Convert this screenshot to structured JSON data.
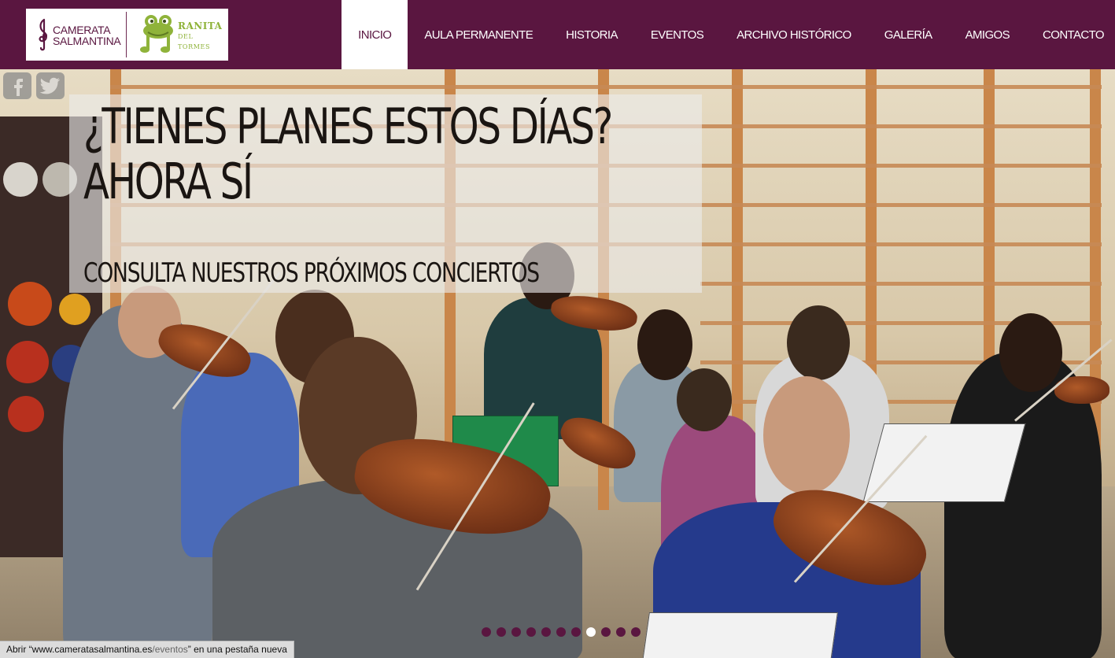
{
  "header": {
    "logo_primary": [
      "CAMERATA",
      "SALMANTINA"
    ],
    "logo_secondary": [
      "RANITA",
      "DEL TORMES"
    ],
    "brand_color": "#5a1640",
    "accent_green": "#8fb33a"
  },
  "nav": {
    "items": [
      {
        "label": "INICIO",
        "active": true
      },
      {
        "label": "AULA PERMANENTE",
        "active": false
      },
      {
        "label": "HISTORIA",
        "active": false
      },
      {
        "label": "EVENTOS",
        "active": false
      },
      {
        "label": "ARCHIVO HISTÓRICO",
        "active": false
      },
      {
        "label": "GALERÍA",
        "active": false
      },
      {
        "label": "AMIGOS",
        "active": false
      },
      {
        "label": "CONTACTO",
        "active": false
      }
    ]
  },
  "social": {
    "icons": [
      "facebook-icon",
      "twitter-icon"
    ]
  },
  "hero": {
    "title_line1": "¿TIENES PLANES ESTOS DÍAS?",
    "title_line2": "AHORA SÍ",
    "subtitle": "CONSULTA NUESTROS PRÓXIMOS CONCIERTOS"
  },
  "slider": {
    "dot_count": 11,
    "active_index": 7
  },
  "status": {
    "prefix": "Abrir “www.camerata salmantina.es",
    "domain": "www.cameratasalmantina.es",
    "path": "/eventos",
    "suffix": "” en una pestaña nueva",
    "open_text": "Abrir “"
  }
}
